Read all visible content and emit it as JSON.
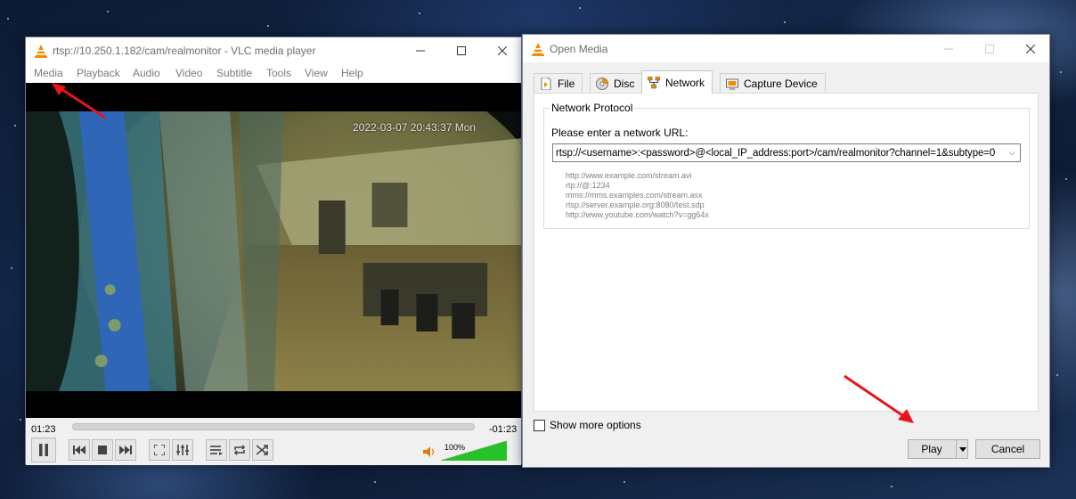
{
  "vlc": {
    "title": "rtsp://10.250.1.182/cam/realmonitor - VLC media player",
    "menu": [
      "Media",
      "Playback",
      "Audio",
      "Video",
      "Subtitle",
      "Tools",
      "View",
      "Help"
    ],
    "osd_timestamp": "2022-03-07 20:43:37 Mon",
    "time_elapsed": "01:23",
    "time_remaining": "-01:23",
    "volume": "100%",
    "volume_level": 1.0
  },
  "dialog": {
    "title": "Open Media",
    "tabs": [
      "File",
      "Disc",
      "Network",
      "Capture Device"
    ],
    "active_tab": "Network",
    "group_label": "Network Protocol",
    "url_prompt": "Please enter a network URL:",
    "url_value": "rtsp://<username>:<password>@<local_IP_address:port>/cam/realmonitor?channel=1&subtype=0",
    "examples": [
      "http://www.example.com/stream.avi",
      "rtp://@:1234",
      "mms://mms.examples.com/stream.asx",
      "rtsp://server.example.org:8080/test.sdp",
      "http://www.youtube.com/watch?v=gg64x"
    ],
    "show_more_options": "Show more options",
    "play_label": "Play",
    "cancel_label": "Cancel"
  },
  "colors": {
    "vlc_orange": "#f28c00",
    "annotation_arrow": "#e8141b",
    "volume_fill": "#27c227"
  }
}
